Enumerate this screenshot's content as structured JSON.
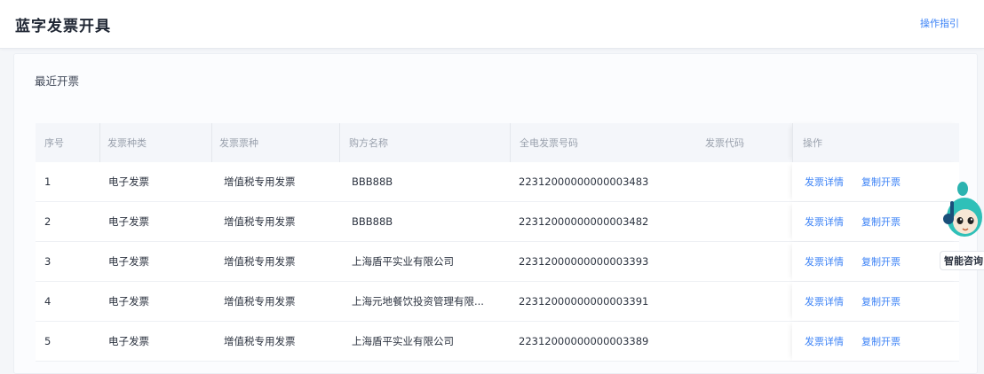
{
  "header": {
    "title": "蓝字发票开具",
    "guide_link": "操作指引"
  },
  "recent": {
    "title": "最近开票",
    "columns": [
      "序号",
      "发票种类",
      "发票票种",
      "购方名称",
      "全电发票号码",
      "发票代码",
      "操作"
    ],
    "rows": [
      {
        "index": "1",
        "kind": "电子发票",
        "type": "增值税专用发票",
        "buyer": "BBB88B",
        "number": "22312000000000003483",
        "code": "",
        "op_detail": "发票详情",
        "op_reissue": "复制开票"
      },
      {
        "index": "2",
        "kind": "电子发票",
        "type": "增值税专用发票",
        "buyer": "BBB88B",
        "number": "22312000000000003482",
        "code": "",
        "op_detail": "发票详情",
        "op_reissue": "复制开票"
      },
      {
        "index": "3",
        "kind": "电子发票",
        "type": "增值税专用发票",
        "buyer": "上海盾平实业有限公司",
        "number": "22312000000000003393",
        "code": "",
        "op_detail": "发票详情",
        "op_reissue": "复制开票"
      },
      {
        "index": "4",
        "kind": "电子发票",
        "type": "增值税专用发票",
        "buyer": "上海元地餐饮投资管理有限...",
        "number": "22312000000000003391",
        "code": "",
        "op_detail": "发票详情",
        "op_reissue": "复制开票"
      },
      {
        "index": "5",
        "kind": "电子发票",
        "type": "增值税专用发票",
        "buyer": "上海盾平实业有限公司",
        "number": "22312000000000003389",
        "code": "",
        "op_detail": "发票详情",
        "op_reissue": "复制开票"
      }
    ]
  },
  "assistant": {
    "label": "智能咨询",
    "icon": "assistant-avatar-icon"
  },
  "colors": {
    "accent": "#3b82f6",
    "header_bg": "#f4f6fa"
  }
}
